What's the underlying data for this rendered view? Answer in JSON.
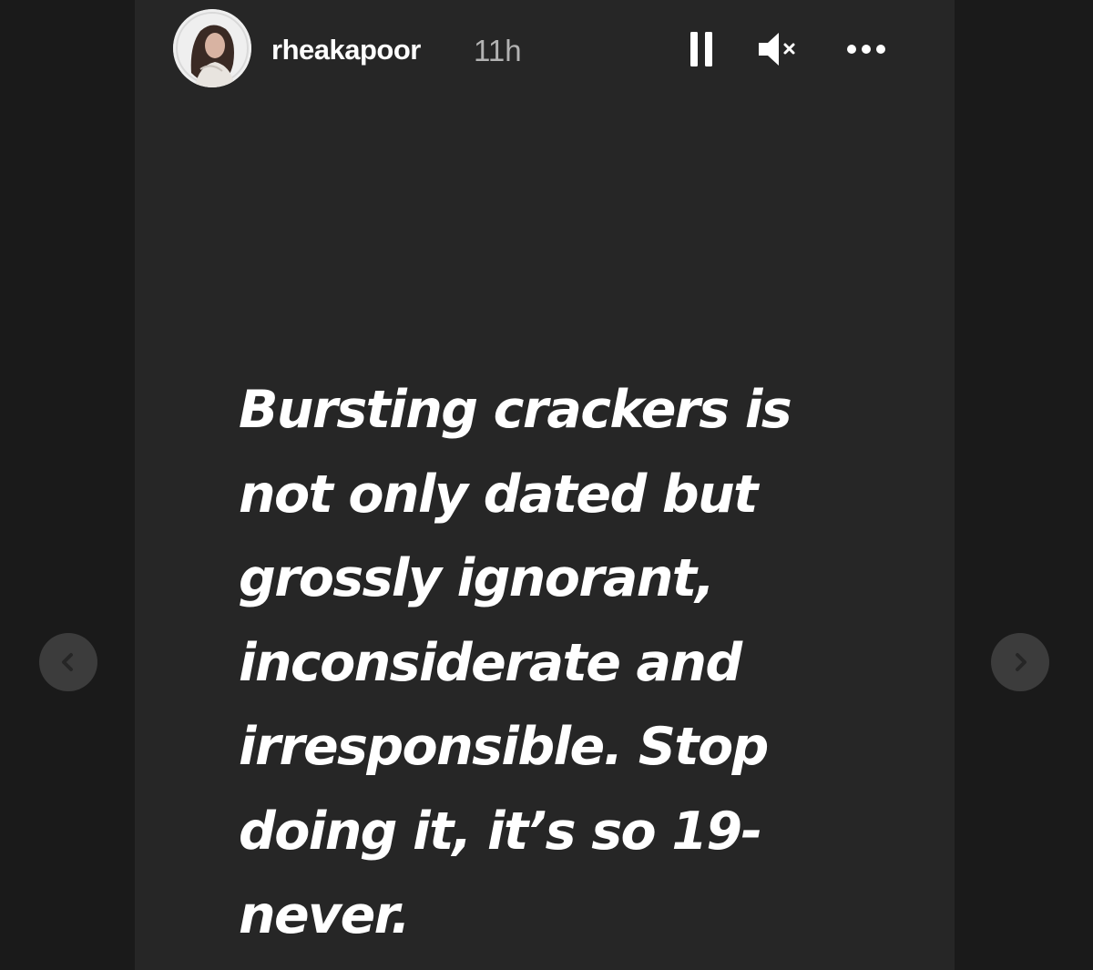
{
  "story": {
    "username": "rheakapoor",
    "time_ago": "11h",
    "text": "Bursting crackers is not only dated but grossly ignorant, inconsiderate and irresponsible. Stop doing it, it’s so 19-never.",
    "controls": {
      "pause_icon": "pause-icon",
      "mute_icon": "speaker-muted-icon",
      "more_icon": "more-options-icon"
    }
  },
  "navigation": {
    "prev_icon": "chevron-left-icon",
    "next_icon": "chevron-right-icon"
  },
  "colors": {
    "page_background": "#1a1a1a",
    "story_background": "#262626",
    "text": "#ffffff",
    "secondary_text": "#b3b3b3",
    "nav_button": "#3c3c3c"
  }
}
